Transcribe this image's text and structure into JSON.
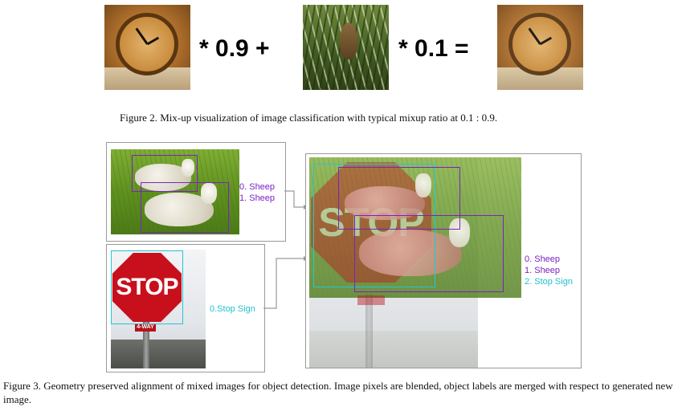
{
  "figure2": {
    "multiplier_a": "* 0.9 +",
    "multiplier_b": "* 0.1 =",
    "caption": "Figure 2. Mix-up visualization of image classification with typical mixup ratio at 0.1 : 0.9."
  },
  "figure3": {
    "sheep_panel": {
      "labels": [
        "0. Sheep",
        "1. Sheep"
      ]
    },
    "stop_panel": {
      "label": "0.Stop Sign",
      "sign_text": "STOP",
      "way_text": "4-WAY"
    },
    "merged_panel": {
      "labels": [
        "0. Sheep",
        "1. Sheep",
        "2. Stop Sign"
      ],
      "sign_text": "STOP"
    },
    "caption": "Figure 3. Geometry preserved alignment of mixed images for object detection. Image pixels are blended, object labels are merged with respect to generated new image."
  },
  "colors": {
    "box_purple": "#7b22c3",
    "box_cyan": "#22c8d2",
    "panel_border": "#9a9a9a"
  }
}
